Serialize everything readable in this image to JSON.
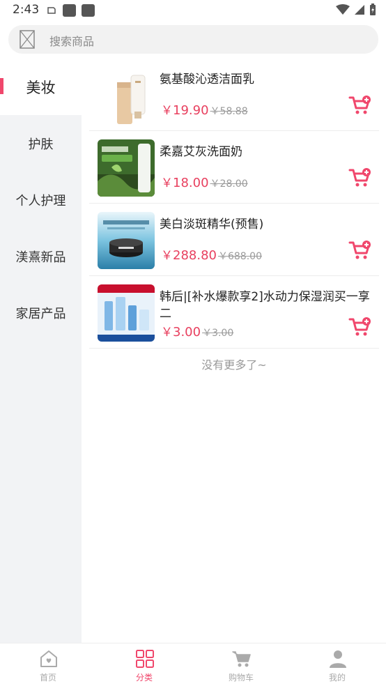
{
  "status_bar": {
    "time": "2:43"
  },
  "search": {
    "placeholder": "搜索商品"
  },
  "sidebar": {
    "items": [
      {
        "label": "美妆",
        "active": true
      },
      {
        "label": "护肤",
        "active": false
      },
      {
        "label": "个人护理",
        "active": false
      },
      {
        "label": "渼熹新品",
        "active": false
      },
      {
        "label": "家居产品",
        "active": false
      }
    ]
  },
  "products": [
    {
      "name": "氨基酸沁透洁面乳",
      "currency": "￥",
      "price": "19.90",
      "original_price": "￥58.88"
    },
    {
      "name": "柔嘉艾灰洗面奶",
      "currency": "￥",
      "price": "18.00",
      "original_price": "￥28.00"
    },
    {
      "name": "美白淡斑精华(预售)",
      "currency": "￥",
      "price": "288.80",
      "original_price": "￥688.00"
    },
    {
      "name": "韩后|[补水爆款享2]水动力保湿润买一享二",
      "currency": "￥",
      "price": "3.00",
      "original_price": "￥3.00"
    }
  ],
  "list_footer": "没有更多了~",
  "tab_bar": {
    "tabs": [
      {
        "label": "首页",
        "icon": "home-icon",
        "active": false
      },
      {
        "label": "分类",
        "icon": "category-icon",
        "active": true
      },
      {
        "label": "购物车",
        "icon": "cart-icon",
        "active": false
      },
      {
        "label": "我的",
        "icon": "user-icon",
        "active": false
      }
    ]
  },
  "colors": {
    "accent": "#f0476c",
    "price": "#e8405f"
  }
}
